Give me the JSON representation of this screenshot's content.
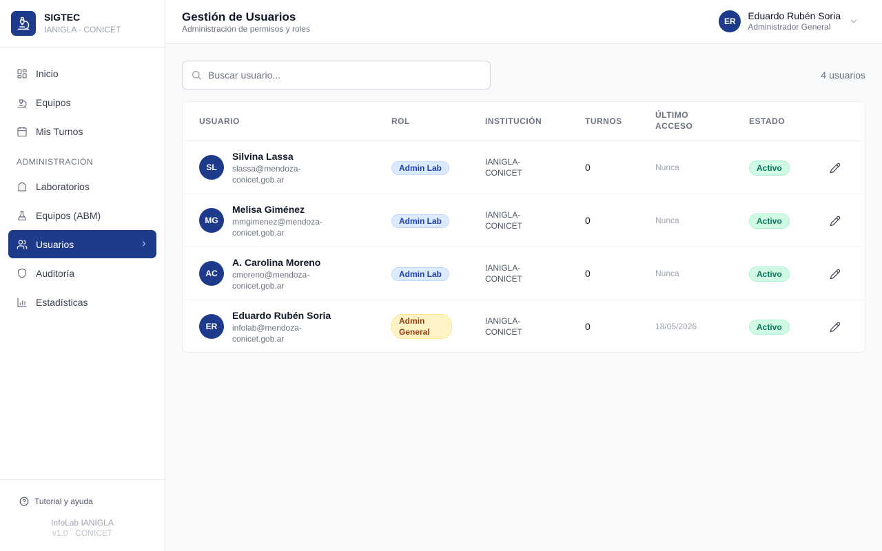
{
  "brand": {
    "name": "SIGTEC",
    "subtitle": "IANIGLA · CONICET"
  },
  "sidebar": {
    "items": [
      {
        "label": "Inicio",
        "icon": "grid-icon"
      },
      {
        "label": "Equipos",
        "icon": "microscope-icon"
      },
      {
        "label": "Mis Turnos",
        "icon": "calendar-icon"
      }
    ],
    "section_label": "ADMINISTRACIÓN",
    "admin_items": [
      {
        "label": "Laboratorios",
        "icon": "building-icon"
      },
      {
        "label": "Equipos (ABM)",
        "icon": "flask-icon"
      },
      {
        "label": "Usuarios",
        "icon": "users-icon",
        "active": true
      },
      {
        "label": "Auditoría",
        "icon": "shield-icon"
      },
      {
        "label": "Estadísticas",
        "icon": "bar-chart-icon"
      }
    ],
    "help_label": "Tutorial y ayuda",
    "footer_name": "InfoLab IANIGLA",
    "footer_version": "v1.0 · CONICET"
  },
  "header": {
    "title": "Gestión de Usuarios",
    "subtitle": "Administración de permisos y roles",
    "user": {
      "initials": "ER",
      "name": "Eduardo Rubén Soria",
      "role": "Administrador General"
    }
  },
  "search": {
    "placeholder": "Buscar usuario...",
    "value": ""
  },
  "count_label": "4 usuarios",
  "table": {
    "columns": {
      "usuario": "USUARIO",
      "rol": "ROL",
      "institucion": "INSTITUCIÓN",
      "turnos": "TURNOS",
      "acceso_1": "ÚLTIMO",
      "acceso_2": "ACCESO",
      "estado": "ESTADO"
    },
    "rows": [
      {
        "initials": "SL",
        "name": "Silvina Lassa",
        "email": "slassa@mendoza-conicet.gob.ar",
        "role": "Admin Lab",
        "inst": "IANIGLA-CONICET",
        "turnos": "0",
        "acceso": "Nunca",
        "estado": "Activo"
      },
      {
        "initials": "MG",
        "name": "Melisa Giménez",
        "email": "mmgimenez@mendoza-conicet.gob.ar",
        "role": "Admin Lab",
        "inst": "IANIGLA-CONICET",
        "turnos": "0",
        "acceso": "Nunca",
        "estado": "Activo"
      },
      {
        "initials": "AC",
        "name": "A. Carolina Moreno",
        "email": "cmoreno@mendoza-conicet.gob.ar",
        "role": "Admin Lab",
        "inst": "IANIGLA-CONICET",
        "turnos": "0",
        "acceso": "Nunca",
        "estado": "Activo"
      },
      {
        "initials": "ER",
        "name": "Eduardo Rubén Soria",
        "email": "infolab@mendoza-conicet.gob.ar",
        "role": "Admin General",
        "inst": "IANIGLA-CONICET",
        "turnos": "0",
        "acceso": "18/05/2026",
        "estado": "Activo"
      }
    ]
  },
  "colors": {
    "primary": "#1e3a8a",
    "active_status": "#047857",
    "lab_badge": "#1e40af",
    "general_badge": "#92400e"
  }
}
